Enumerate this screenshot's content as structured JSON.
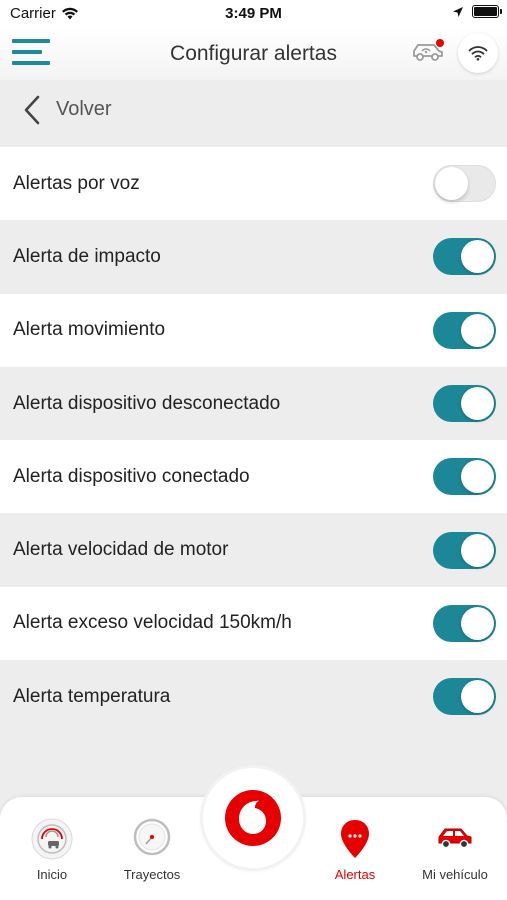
{
  "status_bar": {
    "carrier": "Carrier",
    "time": "3:49 PM"
  },
  "header": {
    "title": "Configurar alertas",
    "menu_icon": "hamburger-menu-icon",
    "car_icon": "car-alert-icon",
    "wifi_icon": "wifi-icon"
  },
  "back": {
    "label": "Volver"
  },
  "alerts": [
    {
      "label": "Alertas por voz",
      "enabled": false
    },
    {
      "label": "Alerta de impacto",
      "enabled": true
    },
    {
      "label": "Alerta movimiento",
      "enabled": true
    },
    {
      "label": "Alerta dispositivo desconectado",
      "enabled": true
    },
    {
      "label": "Alerta dispositivo conectado",
      "enabled": true
    },
    {
      "label": "Alerta velocidad de motor",
      "enabled": true
    },
    {
      "label": "Alerta exceso velocidad 150km/h",
      "enabled": true
    },
    {
      "label": "Alerta temperatura",
      "enabled": true
    }
  ],
  "tabs": [
    {
      "label": "Inicio",
      "icon": "dashboard-gauge-icon",
      "active": false
    },
    {
      "label": "Trayectos",
      "icon": "compass-icon",
      "active": false
    },
    {
      "label": "Alertas",
      "icon": "alert-pin-icon",
      "active": true
    },
    {
      "label": "Mi vehículo",
      "icon": "car-icon",
      "active": false
    }
  ],
  "colors": {
    "accent": "#1c8797",
    "brand_red": "#e60000",
    "toggle_off": "#e9e9e9"
  }
}
